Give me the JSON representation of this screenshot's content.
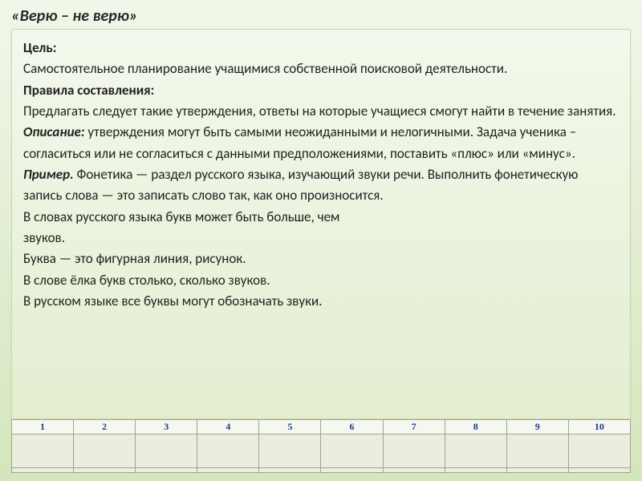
{
  "title": "«Верю – не верю»",
  "labels": {
    "goal": "Цель:",
    "rules": "Правила составления:",
    "description": "Описание:",
    "example": "Пример."
  },
  "body": {
    "goal_text": "Самостоятельное планирование учащимися собственной поисковой деятельности.",
    "rules_text_before": "Предлагать следует такие утверждения, ответы на которые учащиеся смогут найти в течение занятия. ",
    "description_text": " утверждения могут быть самыми неожиданными и нелогичными. Задача ученика – согласиться или не согласиться с данными предположениями, поставить «плюс» или «минус».",
    "example_text": " Фонетика — раздел русского языка, изучающий звуки речи. Выполнить фонетическую запись слова — это записать слово так, как оно произносится.",
    "line1": "В словах русского языка букв может быть больше, чем",
    "line2": "звуков.",
    "line3": "Буква — это фигурная линия, рисунок.",
    "line4": "В слове ёлка букв столько, сколько звуков.",
    "line5": "В русском языке все буквы могут обозначать звуки."
  },
  "table": {
    "headers": [
      "1",
      "2",
      "3",
      "4",
      "5",
      "6",
      "7",
      "8",
      "9",
      "10"
    ]
  }
}
